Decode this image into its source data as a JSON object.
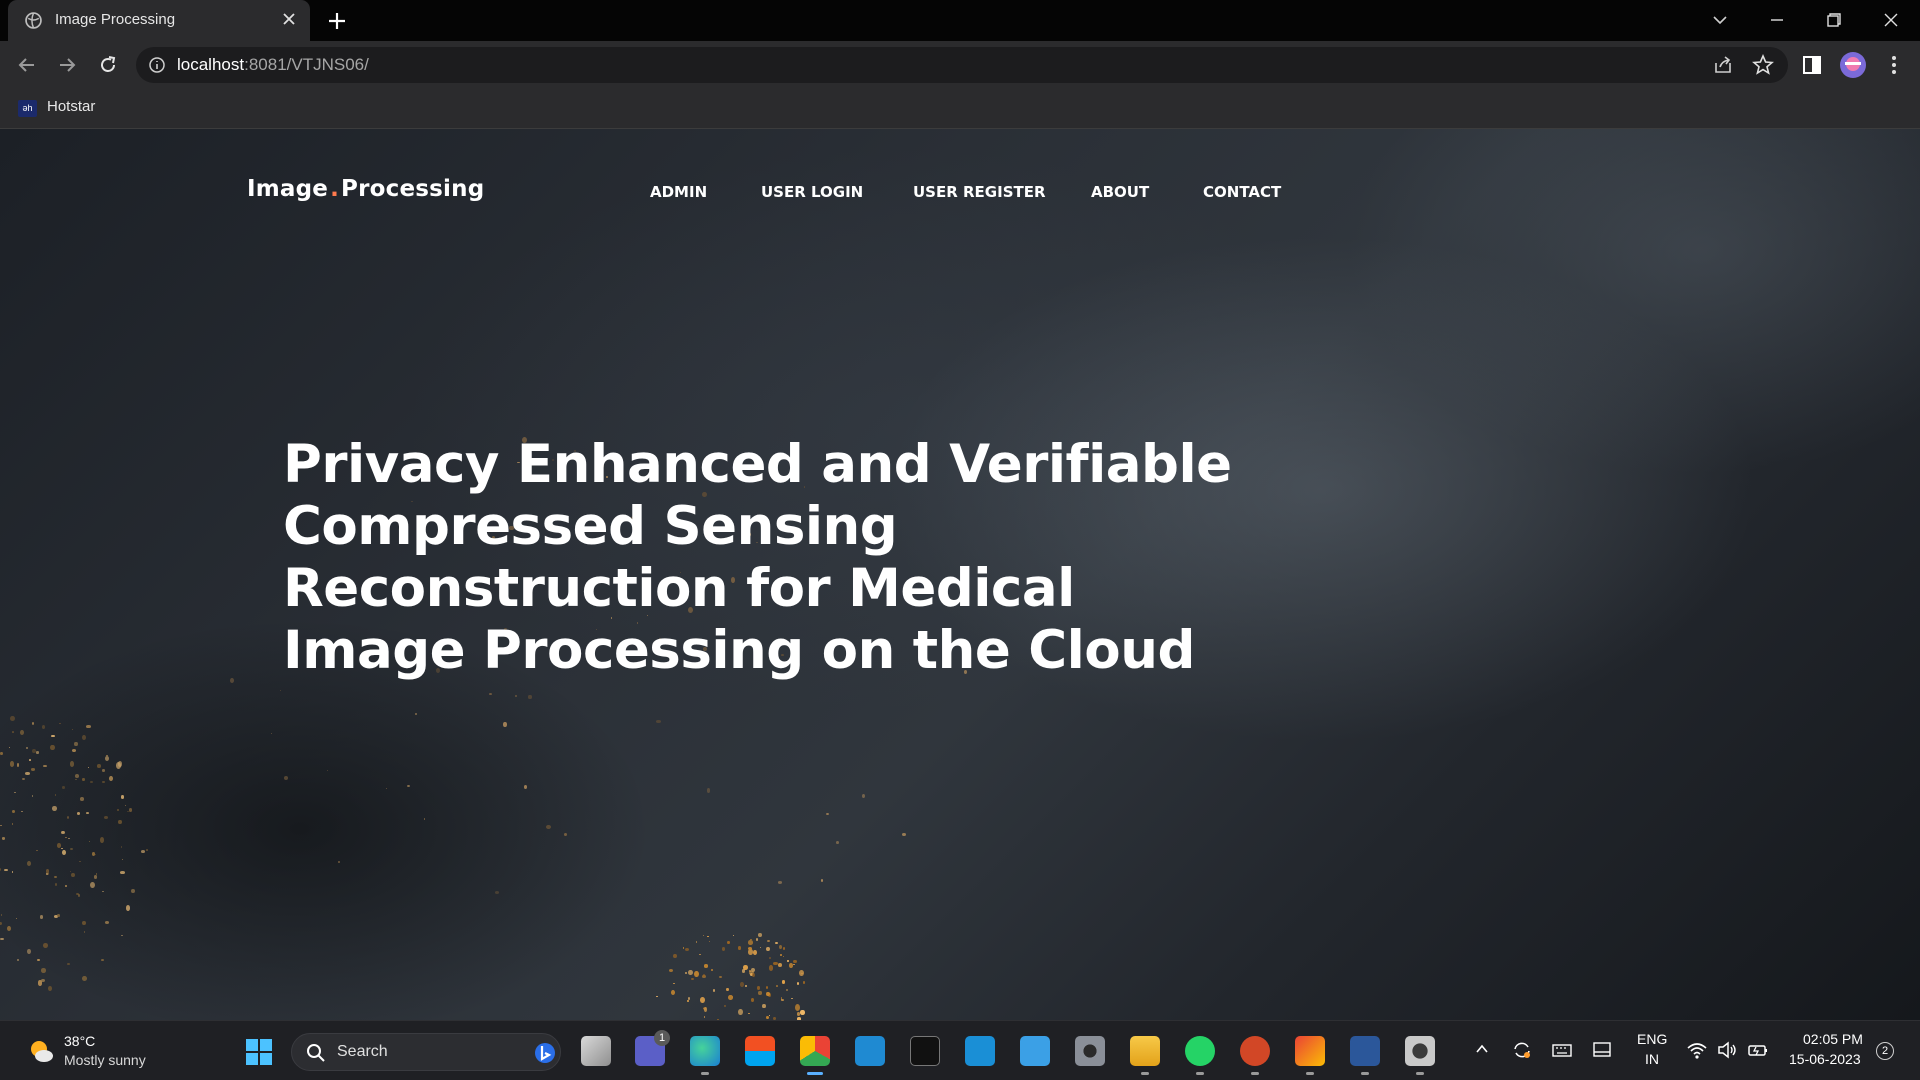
{
  "browser": {
    "tab_title": "Image Processing",
    "url_host": "localhost",
    "url_path": ":8081/VTJNS06/",
    "bookmarks": [
      {
        "label": "Hotstar",
        "favicon_text": "əh"
      }
    ]
  },
  "site": {
    "logo_left": "Image",
    "logo_dot": ".",
    "logo_right": "Processing",
    "nav": [
      "ADMIN",
      "USER LOGIN",
      "USER REGISTER",
      "ABOUT",
      "CONTACT"
    ],
    "hero_lines": [
      "Privacy Enhanced and Verifiable",
      "Compressed Sensing",
      "Reconstruction for Medical",
      "Image Processing on the Cloud"
    ],
    "accent_color": "#ff7a4d"
  },
  "taskbar": {
    "weather_temp": "38°C",
    "weather_desc": "Mostly sunny",
    "search_placeholder": "Search",
    "apps": [
      "task-view",
      "teams",
      "edge",
      "store",
      "chrome",
      "vscode",
      "terminal",
      "myhp",
      "notepad",
      "settings",
      "file-explorer",
      "whatsapp",
      "powerpoint",
      "gmail",
      "word",
      "system-tool"
    ],
    "teams_badge": "1",
    "lang_line1": "ENG",
    "lang_line2": "IN",
    "time": "02:05 PM",
    "date": "15-06-2023",
    "notification_count": "2"
  }
}
